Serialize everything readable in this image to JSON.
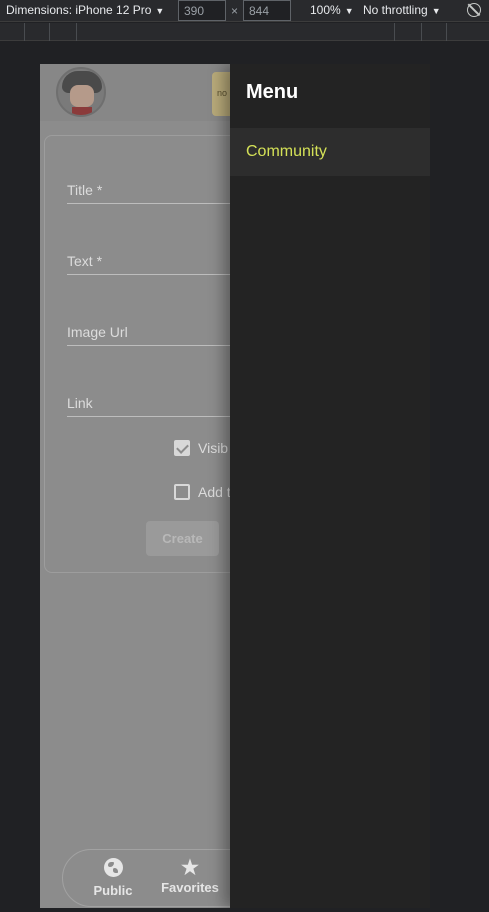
{
  "devtools": {
    "dimensions_label": "Dimensions: iPhone 12 Pro",
    "width": "390",
    "height": "844",
    "times": "×",
    "zoom": "100%",
    "throttling": "No throttling"
  },
  "app": {
    "badge_text": "no",
    "form": {
      "title_label": "Title *",
      "text_label": "Text *",
      "image_url_label": "Image Url",
      "link_label": "Link",
      "visible_label": "Visib",
      "visible_checked": true,
      "add_label": "Add t",
      "add_checked": false,
      "create_label": "Create"
    },
    "bottom_nav": {
      "public_label": "Public",
      "favorites_label": "Favorites"
    },
    "drawer": {
      "title": "Menu",
      "items": [
        {
          "label": "Community",
          "active": true
        }
      ]
    }
  },
  "colors": {
    "drawer_bg": "#232323",
    "active_item": "#d4e157",
    "scrim_gray": "#8c8c8c"
  }
}
